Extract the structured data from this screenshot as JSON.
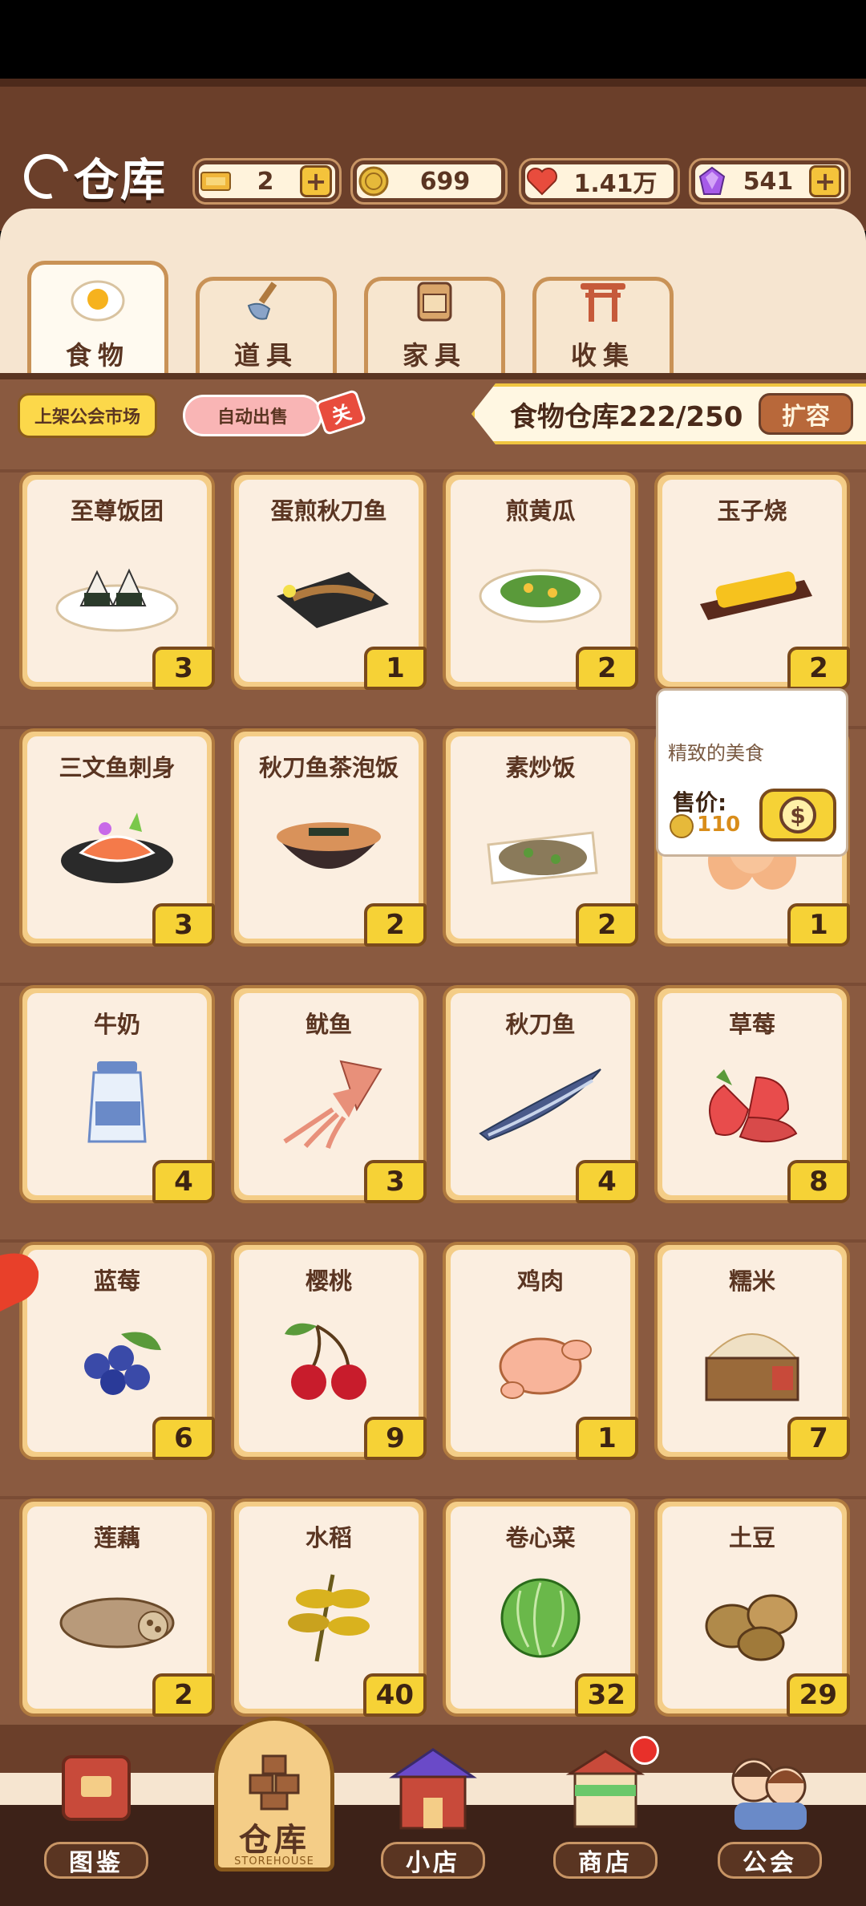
{
  "header": {
    "title": "仓库",
    "resources": [
      {
        "name": "ticket",
        "value": "2",
        "has_plus": true,
        "color": "#f0b63a"
      },
      {
        "name": "coin",
        "value": "699",
        "has_plus": false,
        "color": "#e6b93a"
      },
      {
        "name": "heart",
        "value": "1.41万",
        "has_plus": false,
        "color": "#e84c3d"
      },
      {
        "name": "gem",
        "value": "541",
        "has_plus": true,
        "color": "#a65be8"
      }
    ]
  },
  "tabs": [
    {
      "label": "食物",
      "icon": "egg-icon",
      "active": true
    },
    {
      "label": "道具",
      "icon": "shovel-icon",
      "active": false
    },
    {
      "label": "家具",
      "icon": "cabinet-icon",
      "active": false
    },
    {
      "label": "收集",
      "icon": "torii-icon",
      "active": false
    }
  ],
  "toolbar": {
    "market_label": "上架公会市场",
    "auto_sell_label": "自动出售",
    "auto_sell_tag": "关",
    "storage_text": "食物仓库222/250",
    "expand_label": "扩容"
  },
  "items": [
    {
      "name": "至尊饭团",
      "count": "3",
      "icon": "rice-ball-icon"
    },
    {
      "name": "蛋煎秋刀鱼",
      "count": "1",
      "icon": "fried-saury-icon"
    },
    {
      "name": "煎黄瓜",
      "count": "2",
      "icon": "fried-cucumber-icon"
    },
    {
      "name": "玉子烧",
      "count": "2",
      "icon": "tamagoyaki-icon"
    },
    {
      "name": "三文鱼刺身",
      "count": "3",
      "icon": "salmon-sashimi-icon"
    },
    {
      "name": "秋刀鱼茶泡饭",
      "count": "2",
      "icon": "ochazuke-icon"
    },
    {
      "name": "素炒饭",
      "count": "2",
      "icon": "fried-rice-icon"
    },
    {
      "name": "",
      "count": "1",
      "icon": "egg-icon"
    },
    {
      "name": "牛奶",
      "count": "4",
      "icon": "milk-icon"
    },
    {
      "name": "鱿鱼",
      "count": "3",
      "icon": "squid-icon"
    },
    {
      "name": "秋刀鱼",
      "count": "4",
      "icon": "saury-icon"
    },
    {
      "name": "草莓",
      "count": "8",
      "icon": "strawberry-icon"
    },
    {
      "name": "蓝莓",
      "count": "6",
      "icon": "blueberry-icon"
    },
    {
      "name": "樱桃",
      "count": "9",
      "icon": "cherry-icon"
    },
    {
      "name": "鸡肉",
      "count": "1",
      "icon": "chicken-icon"
    },
    {
      "name": "糯米",
      "count": "7",
      "icon": "rice-icon"
    },
    {
      "name": "莲藕",
      "count": "2",
      "icon": "lotus-root-icon"
    },
    {
      "name": "水稻",
      "count": "40",
      "icon": "rice-plant-icon"
    },
    {
      "name": "卷心菜",
      "count": "32",
      "icon": "cabbage-icon"
    },
    {
      "name": "土豆",
      "count": "29",
      "icon": "potato-icon"
    }
  ],
  "tooltip": {
    "desc": "精致的美食",
    "price_label": "售价:",
    "price": "110"
  },
  "nav": [
    {
      "label": "图鉴",
      "icon": "book-icon",
      "active": false
    },
    {
      "label": "仓库",
      "sub": "STOREHOUSE",
      "icon": "boxes-icon",
      "active": true
    },
    {
      "label": "小店",
      "icon": "shop-icon",
      "active": false
    },
    {
      "label": "商店",
      "icon": "store-icon",
      "active": false
    },
    {
      "label": "公会",
      "icon": "guild-icon",
      "active": false
    }
  ]
}
